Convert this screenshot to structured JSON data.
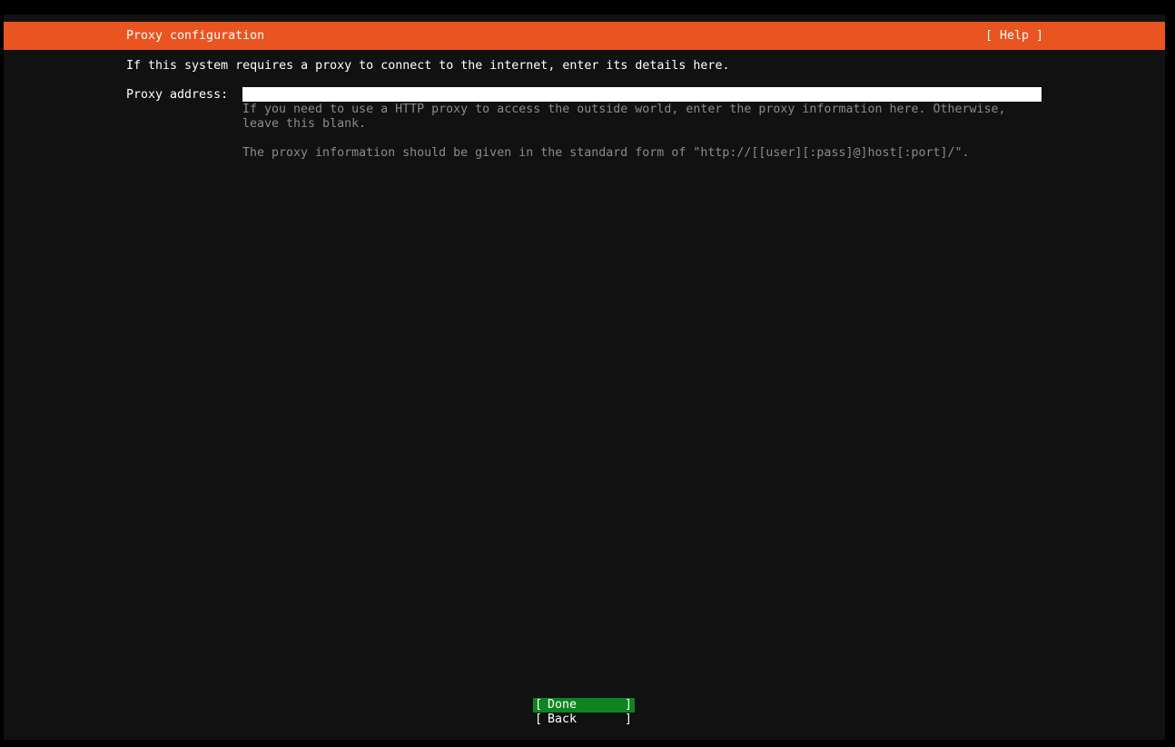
{
  "header": {
    "title": "Proxy configuration",
    "help_label": "[ Help ]",
    "color": "#e95420"
  },
  "intro": "If this system requires a proxy to connect to the internet, enter its details here.",
  "proxy": {
    "label": "Proxy address:",
    "value": "",
    "hint_line1": "If you need to use a HTTP proxy to access the outside world, enter the proxy information here. Otherwise,",
    "hint_line2": "leave this blank.",
    "hint_format": "The proxy information should be given in the standard form of \"http://[[user][:pass]@]host[:port]/\"."
  },
  "buttons": {
    "bracket_open": "[",
    "bracket_close": "]",
    "done": "Done",
    "back": "Back",
    "done_color": "#0e8420"
  }
}
